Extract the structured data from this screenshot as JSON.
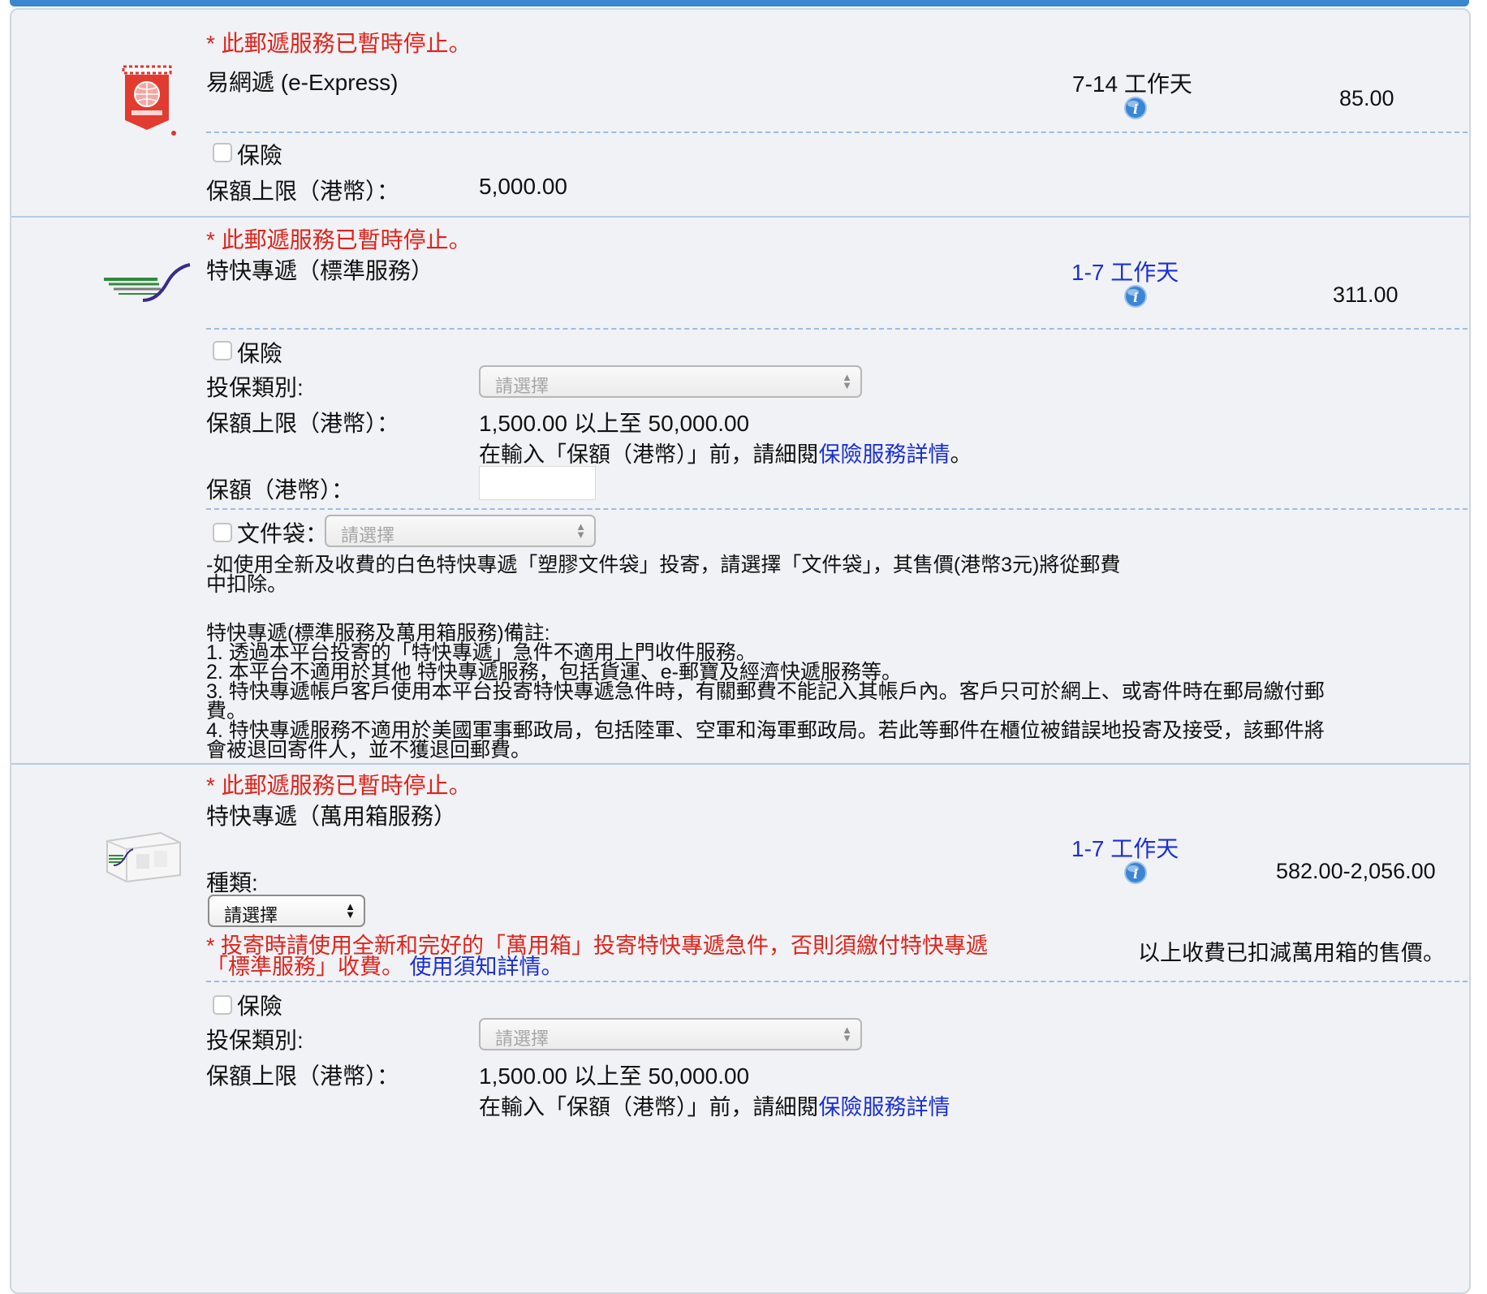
{
  "services": [
    {
      "notice": "* 此郵遞服務已暫時停止。",
      "name": "易網遞 (e-Express)",
      "delivery": "7-14 工作天",
      "price": "85.00",
      "insurance_label": "保險",
      "limit_label": "保額上限（港幣）：",
      "limit_value": "5,000.00"
    },
    {
      "notice": "* 此郵遞服務已暫時停止。",
      "name": "特快專遞（標準服務）",
      "delivery": "1-7 工作天",
      "price": "311.00",
      "insurance_label": "保險",
      "insure_type_label": "投保類別:",
      "select_placeholder": "請選擇",
      "limit_label": "保額上限（港幣）：",
      "limit_value": "1,500.00 以上至 50,000.00",
      "detail_prefix": "在輸入「保額（港幣）」前，請細閱",
      "detail_link": "保險服務詳情",
      "detail_suffix": "。",
      "amount_label": "保額（港幣）：",
      "amount_value": "",
      "envelope_label": "文件袋：",
      "envelope_placeholder": "請選擇",
      "envelope_note_1": "-如使用全新及收費的白色特快專遞「塑膠文件袋」投寄，請選擇「文件袋」，其售價(港幣3元)將從郵費",
      "envelope_note_2": "中扣除。",
      "remarks_title": "特快專遞(標準服務及萬用箱服務)備註:",
      "remarks": [
        "1. 透過本平台投寄的「特快專遞」急件不適用上門收件服務。",
        "2. 本平台不適用於其他 特快專遞服務，包括貨運、e-郵寶及經濟快遞服務等。",
        "3. 特快專遞帳戶客戶使用本平台投寄特快專遞急件時，有關郵費不能記入其帳戶內。客戶只可於網上、或寄件時在郵局繳付郵",
        "費。",
        "4. 特快專遞服務不適用於美國軍事郵政局，包括陸軍、空軍和海軍郵政局。若此等郵件在櫃位被錯誤地投寄及接受，該郵件將",
        "會被退回寄件人，並不獲退回郵費。"
      ]
    },
    {
      "notice": "* 此郵遞服務已暫時停止。",
      "name": "特快專遞（萬用箱服務）",
      "delivery": "1-7 工作天",
      "price": "582.00-2,056.00",
      "kind_label": "種類:",
      "kind_select": "請選擇",
      "warn_1": "* 投寄時請使用全新和完好的「萬用箱」投寄特快專遞急件，否則須繳付特快專遞",
      "warn_2": "「標準服務」收費。",
      "warn_link": "使用須知詳情。",
      "price_note": "以上收費已扣減萬用箱的售價。",
      "insurance_label": "保險",
      "insure_type_label": "投保類別:",
      "select_placeholder": "請選擇",
      "limit_label": "保額上限（港幣）：",
      "limit_value": "1,500.00 以上至 50,000.00",
      "detail_prefix": "在輸入「保額（港幣）」前，請細閱",
      "detail_link": "保險服務詳情"
    }
  ],
  "colors": {
    "accent": "#3a86d1",
    "notice_red": "#e0231b",
    "link_blue": "#1a2fd6",
    "panel_bg": "#f1f2f5"
  },
  "icons": [
    "e-express-logo",
    "speedpost-logo",
    "speedpost-box-logo",
    "info-icon"
  ]
}
